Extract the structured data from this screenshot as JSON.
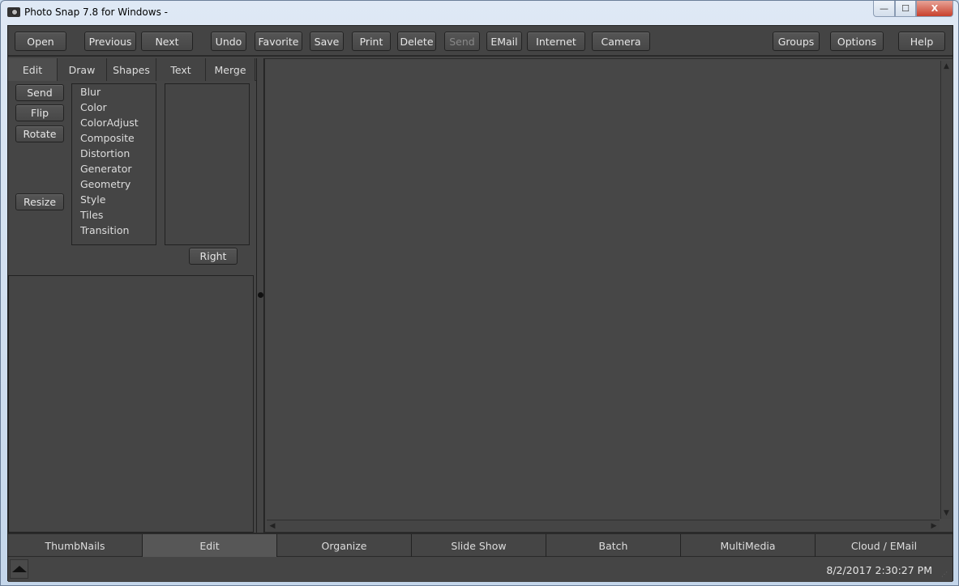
{
  "window": {
    "title": "Photo Snap 7.8 for Windows -",
    "controls": {
      "minimize": "—",
      "maximize": "☐",
      "close": "X"
    }
  },
  "toolbar": {
    "buttons": [
      {
        "label": "Open",
        "enabled": true
      },
      {
        "label": "Previous",
        "enabled": true
      },
      {
        "label": "Next",
        "enabled": true
      },
      {
        "label": "Undo",
        "enabled": true
      },
      {
        "label": "Favorite",
        "enabled": true
      },
      {
        "label": "Save",
        "enabled": true
      },
      {
        "label": "Print",
        "enabled": true
      },
      {
        "label": "Delete",
        "enabled": true
      },
      {
        "label": "Send",
        "enabled": false
      },
      {
        "label": "EMail",
        "enabled": true
      },
      {
        "label": "Internet",
        "enabled": true
      },
      {
        "label": "Camera",
        "enabled": true
      },
      {
        "label": "Groups",
        "enabled": true
      },
      {
        "label": "Options",
        "enabled": true
      },
      {
        "label": "Help",
        "enabled": true
      }
    ]
  },
  "left_panel": {
    "tabs": [
      {
        "label": "Edit",
        "active": true
      },
      {
        "label": "Draw"
      },
      {
        "label": "Shapes"
      },
      {
        "label": "Text"
      },
      {
        "label": "Merge"
      }
    ],
    "side_buttons": [
      "Send",
      "Flip",
      "Rotate",
      "Resize"
    ],
    "filter_categories": [
      "Blur",
      "Color",
      "ColorAdjust",
      "Composite",
      "Distortion",
      "Generator",
      "Geometry",
      "Style",
      "Tiles",
      "Transition"
    ],
    "sub_list_items": [],
    "right_button": "Right"
  },
  "scrollbars": {
    "up": "▲",
    "down": "▼",
    "left": "◀",
    "right": "▶"
  },
  "mode_bar": {
    "tabs": [
      {
        "label": "ThumbNails"
      },
      {
        "label": "Edit",
        "active": true
      },
      {
        "label": "Organize"
      },
      {
        "label": "Slide Show"
      },
      {
        "label": "Batch"
      },
      {
        "label": "MultiMedia"
      },
      {
        "label": "Cloud / EMail"
      }
    ]
  },
  "status": {
    "datetime": "8/2/2017 2:30:27 PM"
  }
}
